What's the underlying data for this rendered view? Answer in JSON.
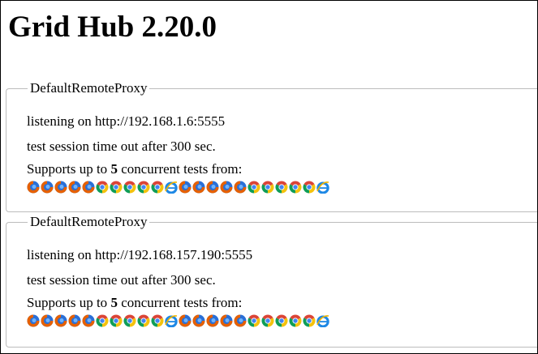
{
  "page": {
    "title": "Grid Hub 2.20.0"
  },
  "proxies": [
    {
      "legend": "DefaultRemoteProxy",
      "listening": "listening on http://192.168.1.6:5555",
      "timeout": "test session time out after 300 sec.",
      "supports_prefix": "Supports up to ",
      "max_sessions": "5",
      "supports_suffix": " concurrent tests from:",
      "browsers": [
        "firefox",
        "firefox",
        "firefox",
        "firefox",
        "firefox",
        "chrome",
        "chrome",
        "chrome",
        "chrome",
        "chrome",
        "internet-explorer",
        "firefox",
        "firefox",
        "firefox",
        "firefox",
        "firefox",
        "chrome",
        "chrome",
        "chrome",
        "chrome",
        "chrome",
        "internet-explorer"
      ]
    },
    {
      "legend": "DefaultRemoteProxy",
      "listening": "listening on http://192.168.157.190:5555",
      "timeout": "test session time out after 300 sec.",
      "supports_prefix": "Supports up to ",
      "max_sessions": "5",
      "supports_suffix": " concurrent tests from:",
      "browsers": [
        "firefox",
        "firefox",
        "firefox",
        "firefox",
        "firefox",
        "chrome",
        "chrome",
        "chrome",
        "chrome",
        "chrome",
        "internet-explorer",
        "firefox",
        "firefox",
        "firefox",
        "firefox",
        "firefox",
        "chrome",
        "chrome",
        "chrome",
        "chrome",
        "chrome",
        "internet-explorer"
      ]
    }
  ],
  "colors": {
    "border": "#bcbcbc",
    "firefox_outer": "#e66000",
    "firefox_inner": "#2a6fd6",
    "chrome_red": "#db4437",
    "chrome_yellow": "#f4c20d",
    "chrome_green": "#0f9d58",
    "chrome_blue": "#4285f4",
    "ie_blue": "#1e88e5",
    "ie_ring": "#f0b400"
  }
}
